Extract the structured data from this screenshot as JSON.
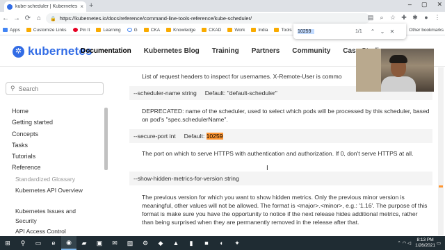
{
  "browser": {
    "tab_title": "kube-scheduler | Kubernetes",
    "tab_close": "×",
    "new_tab": "+",
    "url": "https://kubernetes.io/docs/reference/command-line-tools-reference/kube-scheduler/",
    "nav_back": "←",
    "nav_forward": "→",
    "nav_reload": "⟳",
    "nav_home": "⌂",
    "bookmarks": [
      {
        "label": "Apps",
        "icon": "apps-icon"
      },
      {
        "label": "Customize Links",
        "icon": "folder-icon"
      },
      {
        "label": "Pin It",
        "icon": "pinterest-icon"
      },
      {
        "label": "Learning",
        "icon": "folder-icon"
      },
      {
        "label": "G",
        "icon": "google-icon"
      },
      {
        "label": "CKA",
        "icon": "folder-icon"
      },
      {
        "label": "Knowledge",
        "icon": "folder-icon"
      },
      {
        "label": "CKAD",
        "icon": "folder-icon"
      },
      {
        "label": "Work",
        "icon": "folder-icon"
      },
      {
        "label": "India",
        "icon": "folder-icon"
      },
      {
        "label": "Tools",
        "icon": "folder-icon"
      }
    ],
    "other_bookmarks": "Other bookmarks"
  },
  "find_bar": {
    "query": "10259",
    "count": "1/1",
    "prev": "⌃",
    "next": "⌄",
    "close": "✕"
  },
  "site": {
    "logo": "kubernetes",
    "nav": [
      "Documentation",
      "Kubernetes Blog",
      "Training",
      "Partners",
      "Community",
      "Case Studies"
    ]
  },
  "sidebar": {
    "search_placeholder": "Search",
    "items": [
      {
        "label": "Home",
        "level": 0
      },
      {
        "label": "Getting started",
        "level": 0
      },
      {
        "label": "Concepts",
        "level": 0
      },
      {
        "label": "Tasks",
        "level": 0
      },
      {
        "label": "Tutorials",
        "level": 0
      },
      {
        "label": "Reference",
        "level": 0
      },
      {
        "label": "Standardized Glossary",
        "level": 1
      },
      {
        "label": "Kubernetes API Overview",
        "level": 1
      },
      {
        "label": "Kubernetes Issues and Security",
        "level": 1
      },
      {
        "label": "API Access Control",
        "level": 1
      }
    ]
  },
  "content": {
    "intro": "List of request headers to inspect for usernames. X-Remote-User is commo",
    "flag1_name": "--scheduler-name string",
    "flag1_default_label": "Default:",
    "flag1_default": "\"default-scheduler\"",
    "flag1_desc": "DEPRECATED: name of the scheduler, used to select which pods will be processed by this scheduler, based on pod's \"spec.schedulerName\".",
    "flag2_name": "--secure-port int",
    "flag2_default_label": "Default:",
    "flag2_default": "10259",
    "flag2_desc": "The port on which to serve HTTPS with authentication and authorization. If 0, don't serve HTTPS at all.",
    "flag3_name": "--show-hidden-metrics-for-version string",
    "flag3_desc": "The previous version for which you want to show hidden metrics. Only the previous minor version is meaningful, other values will not be allowed. The format is <major>.<minor>, e.g.: '1.16'. The purpose of this format is make sure you have the opportunity to notice if the next release hides additional metrics, rather than being surprised when they are permanently removed in the release after that."
  },
  "taskbar": {
    "time": "8:13 PM",
    "date": "1/26/2021"
  },
  "colors": {
    "brand": "#326ce5",
    "highlight": "#ff9632"
  }
}
